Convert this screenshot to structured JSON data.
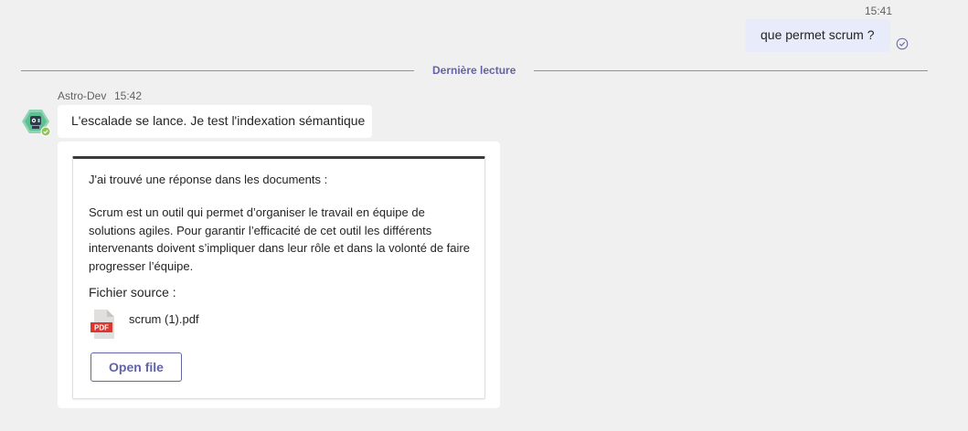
{
  "outgoing": {
    "time": "15:41",
    "text": "que permet scrum ?",
    "status_icon": "read-receipt-icon"
  },
  "divider": {
    "label": "Dernière lecture"
  },
  "incoming": {
    "sender": "Astro-Dev",
    "time": "15:42",
    "avatar_icon": "bot-avatar-icon",
    "text": "L'escalade se lance. Je test l'indexation sémantique",
    "card": {
      "intro": "J'ai trouvé une réponse dans les documents :",
      "body": "Scrum est un outil qui permet d’organiser le travail en équipe de solutions agiles. Pour garantir l’efficacité de cet outil les différents intervenants doivent s’impliquer dans leur rôle et dans la volonté de faire progresser l’équipe.",
      "source_label": "Fichier source :",
      "file": {
        "icon": "pdf-file-icon",
        "badge": "PDF",
        "name": "scrum (1).pdf"
      },
      "button_label": "Open file"
    }
  },
  "colors": {
    "background": "#f0f0f0",
    "outgoing_bubble": "#e8ebfa",
    "accent": "#6264a7",
    "pdf_red": "#d9372f"
  }
}
